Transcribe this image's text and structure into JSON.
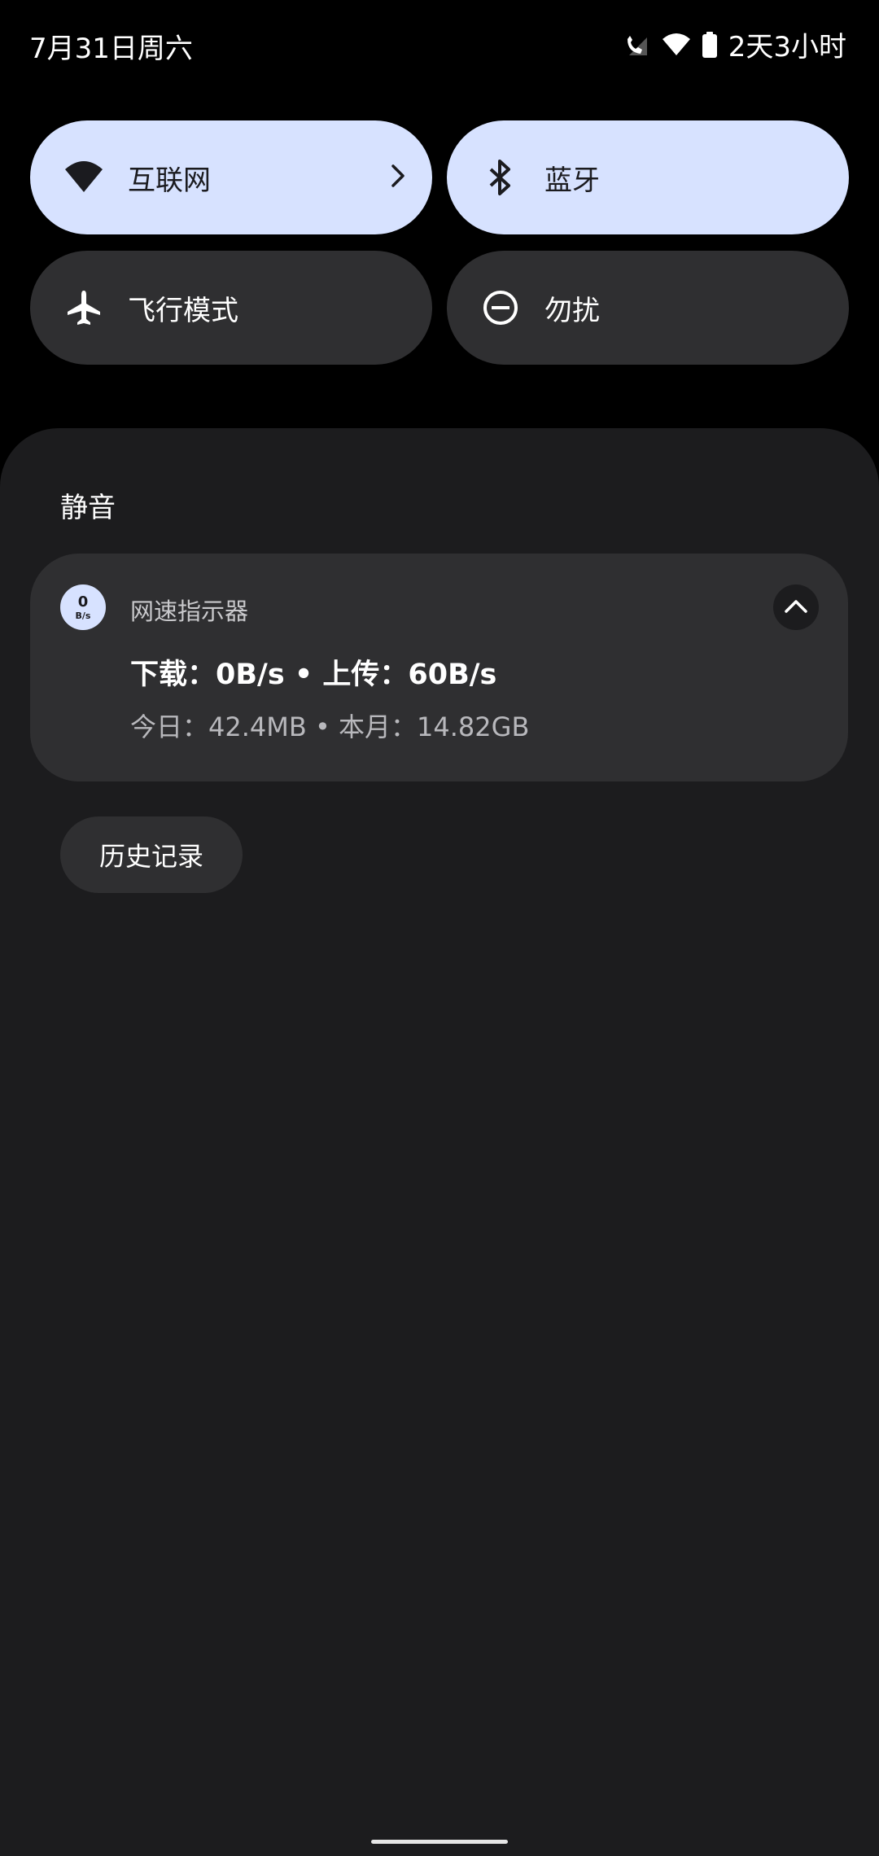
{
  "status": {
    "date": "7月31日周六",
    "battery_text": "2天3小时"
  },
  "tiles": [
    {
      "label": "互联网",
      "icon": "wifi-icon",
      "active": true
    },
    {
      "label": "蓝牙",
      "icon": "bluetooth-icon",
      "active": true
    },
    {
      "label": "飞行模式",
      "icon": "airplane-icon",
      "active": false
    },
    {
      "label": "勿扰",
      "icon": "do-not-disturb-icon",
      "active": false
    }
  ],
  "shade": {
    "section_title": "静音",
    "notification": {
      "app_icon_value": "0",
      "app_icon_unit": "B/s",
      "app_name": "网速指示器",
      "title": "下载：0B/s • 上传：60B/s",
      "text": "今日：42.4MB • 本月：14.82GB"
    },
    "history_button": "历史记录"
  },
  "colors": {
    "tile_active": "#d7e2ff",
    "tile_inactive": "#2f2f31",
    "shade_bg": "#1c1c1e"
  }
}
